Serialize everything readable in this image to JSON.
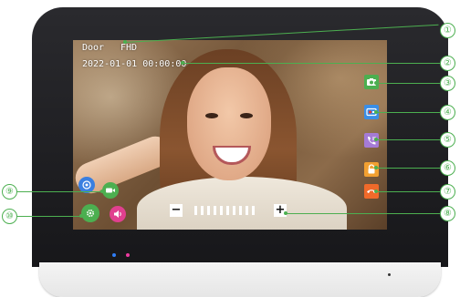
{
  "osd": {
    "source": "Door",
    "quality": "FHD",
    "datetime": "2022-01-01  00:00:00"
  },
  "right_buttons": [
    {
      "icon": "camera-icon",
      "color": "#4caf50"
    },
    {
      "icon": "record-icon",
      "color": "#3a8ee6"
    },
    {
      "icon": "call-transfer-icon",
      "color": "#a57bd6"
    },
    {
      "icon": "unlock-icon",
      "color": "#f2a031"
    },
    {
      "icon": "hangup-icon",
      "color": "#f06a2a"
    }
  ],
  "left_buttons": [
    {
      "icon": "target-icon",
      "color": "#3a7fe0"
    },
    {
      "icon": "video-icon",
      "color": "#4caf50"
    },
    {
      "icon": "settings-icon",
      "color": "#4caf50"
    },
    {
      "icon": "speaker-icon",
      "color": "#e0408f"
    }
  ],
  "volume": {
    "minus_label": "−",
    "plus_label": "+",
    "segments_total": 10
  },
  "callouts": [
    "①",
    "②",
    "③",
    "④",
    "⑤",
    "⑥",
    "⑦",
    "⑧",
    "⑨",
    "⑩"
  ],
  "colors": {
    "callout": "#4caf50",
    "led_blue": "#2f7ef6",
    "led_pink": "#ef3aa0"
  }
}
